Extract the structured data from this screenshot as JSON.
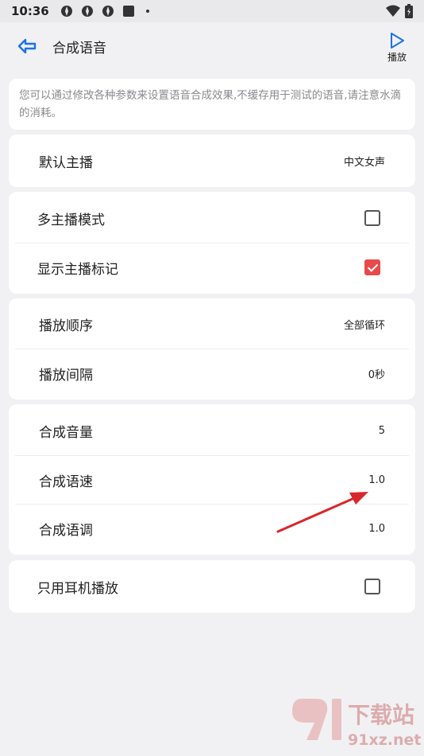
{
  "status_bar": {
    "time": "10:36"
  },
  "app_bar": {
    "title": "合成语音",
    "play_label": "播放"
  },
  "info": {
    "text": "您可以通过修改各种参数来设置语音合成效果,不缓存用于测试的语音,请注意水滴的消耗。"
  },
  "group1": {
    "anchor_label": "默认主播",
    "anchor_value": "中文女声"
  },
  "group2": {
    "multi_label": "多主播模式",
    "multi_checked": false,
    "mark_label": "显示主播标记",
    "mark_checked": true
  },
  "group3": {
    "order_label": "播放顺序",
    "order_value": "全部循环",
    "interval_label": "播放间隔",
    "interval_value": "0秒"
  },
  "group4": {
    "volume_label": "合成音量",
    "volume_value": "5",
    "speed_label": "合成语速",
    "speed_value": "1.0",
    "pitch_label": "合成语调",
    "pitch_value": "1.0"
  },
  "group5": {
    "earphone_label": "只用耳机播放",
    "earphone_checked": false
  },
  "watermark": {
    "text_cn": "下载站",
    "text_url": "91xz.net"
  },
  "colors": {
    "accent_blue": "#1a73e8",
    "check_red": "#e84a4a",
    "arrow_red": "#d9262b"
  }
}
